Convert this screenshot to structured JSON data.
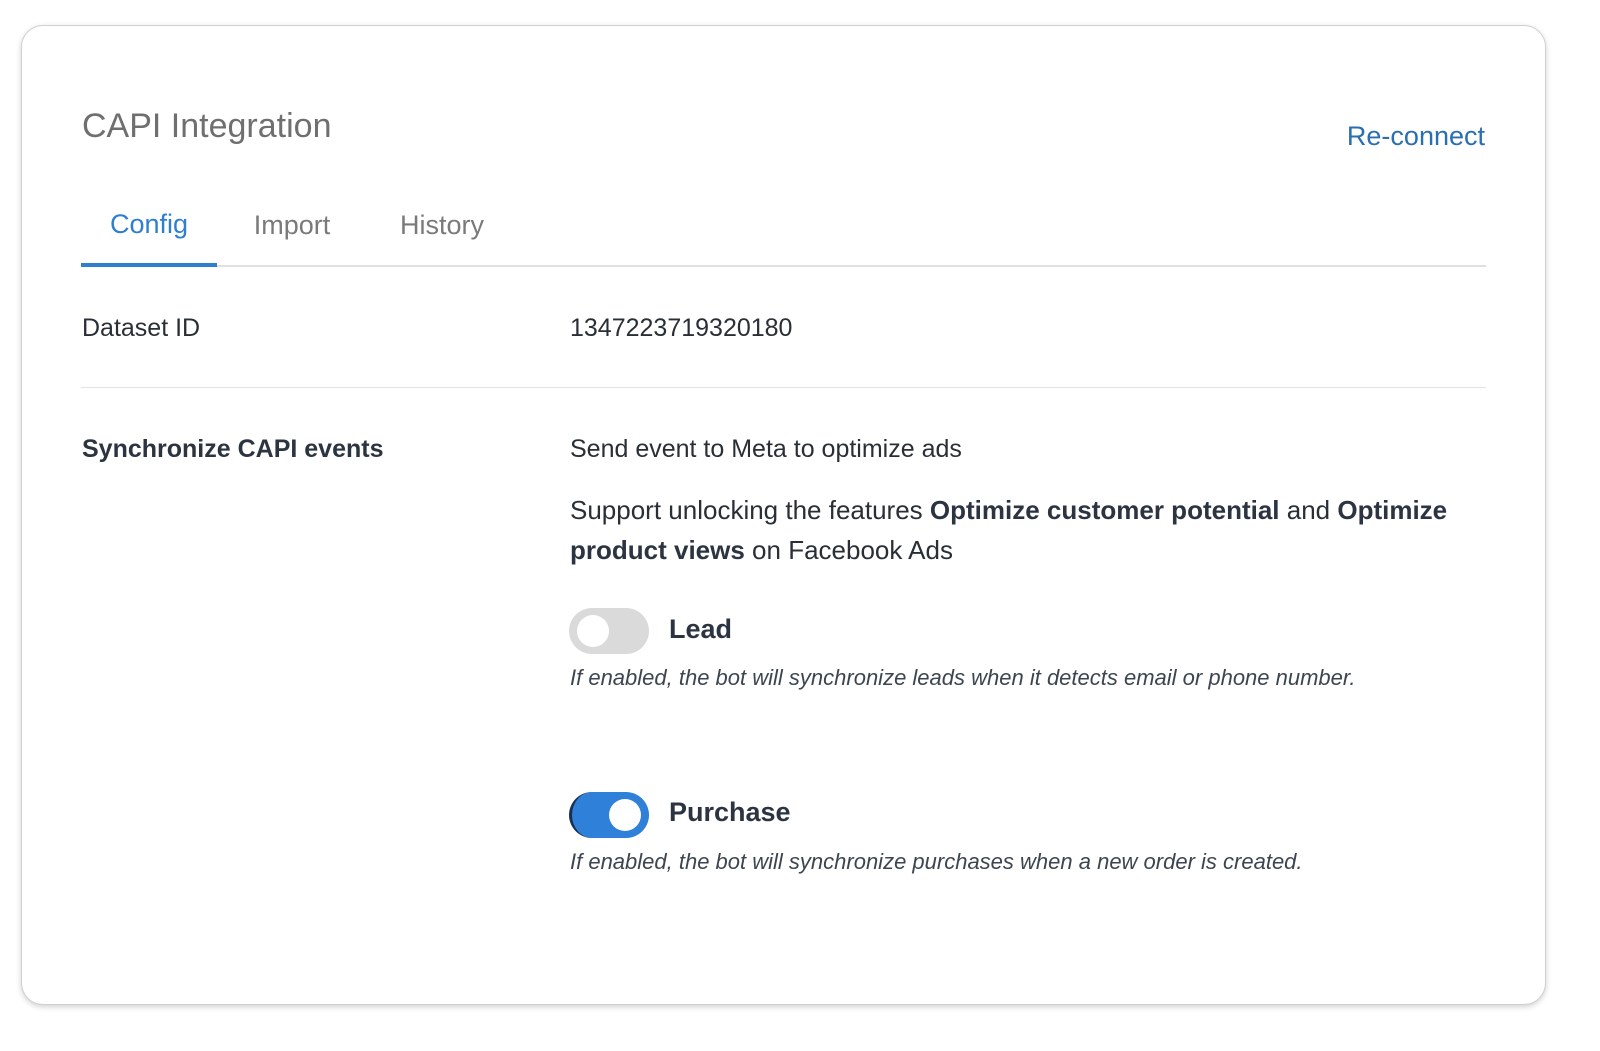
{
  "header": {
    "title": "CAPI Integration",
    "reconnect_label": "Re-connect"
  },
  "tabs": [
    {
      "label": "Config",
      "active": true
    },
    {
      "label": "Import",
      "active": false
    },
    {
      "label": "History",
      "active": false
    }
  ],
  "dataset": {
    "label": "Dataset ID",
    "value": "1347223719320180"
  },
  "sync": {
    "label": "Synchronize CAPI events",
    "description": "Send event to Meta to optimize ads",
    "support": {
      "prefix": "Support unlocking the features ",
      "feature_1": "Optimize customer potential",
      "middle": " and ",
      "feature_2": "Optimize product views",
      "suffix": " on Facebook Ads"
    },
    "events": [
      {
        "label": "Lead",
        "enabled": false,
        "help": "If enabled, the bot will synchronize leads when it detects email or phone number."
      },
      {
        "label": "Purchase",
        "enabled": true,
        "help": "If enabled, the bot will synchronize purchases when a new order is created."
      }
    ]
  },
  "colors": {
    "accent": "#2f7fd0",
    "link": "#2a6fb0",
    "toggle_on": "#2f80d8",
    "toggle_off": "#dadada"
  }
}
